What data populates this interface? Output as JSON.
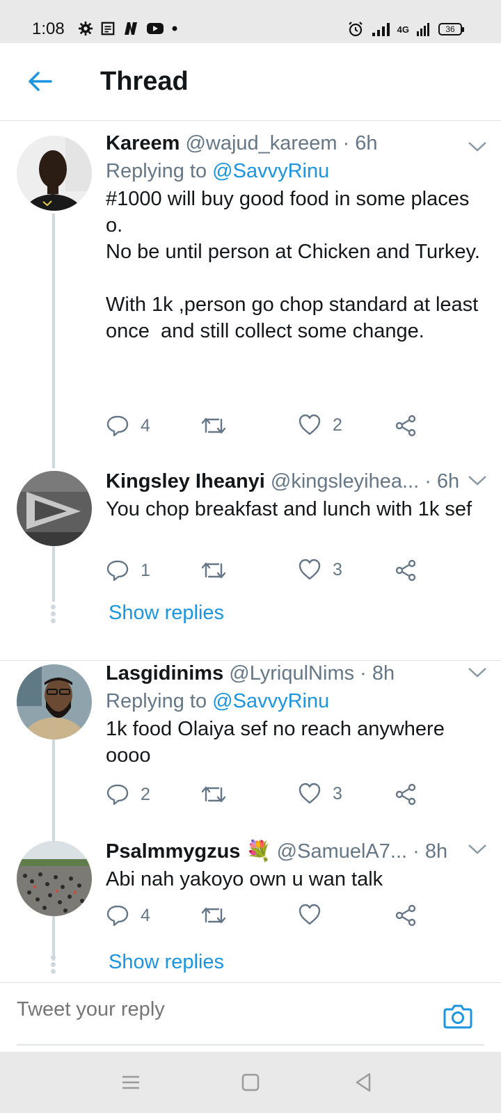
{
  "status_bar": {
    "time": "1:08",
    "battery": "36",
    "network": "4G"
  },
  "header": {
    "title": "Thread"
  },
  "tweets": [
    {
      "name": "Kareem",
      "handle": "@wajud_kareem",
      "time": "· 6h",
      "replying_prefix": "Replying to",
      "replying_to": "@SavvyRinu",
      "text": "#1000 will buy good food in some places o.\nNo be until person at Chicken and Turkey.\n\nWith 1k ,person go chop standard at least once  and still collect some change.",
      "replies": "4",
      "retweets": "",
      "likes": "2"
    },
    {
      "name": "Kingsley Iheanyi",
      "handle": "@kingsleyihea...",
      "time": "· 6h",
      "text": "You chop breakfast and lunch with 1k sef",
      "replies": "1",
      "retweets": "",
      "likes": "3",
      "show_replies": "Show replies"
    },
    {
      "name": "Lasgidinims",
      "handle": "@LyriqulNims",
      "time": "· 8h",
      "replying_prefix": "Replying to",
      "replying_to": "@SavvyRinu",
      "text": "1k food Olaiya sef no reach anywhere oooo",
      "replies": "2",
      "retweets": "",
      "likes": "3"
    },
    {
      "name": "Psalmmygzus",
      "emoji": "💐",
      "handle": "@SamuelA7...",
      "time": "· 8h",
      "text": "Abi nah yakoyo own u wan talk",
      "replies": "4",
      "retweets": "",
      "likes": "",
      "show_replies": "Show replies"
    }
  ],
  "reply_bar": {
    "placeholder": "Tweet your reply"
  },
  "colors": {
    "accent": "#1b95e0",
    "secondary_text": "#657786",
    "thread_line": "#cfd9de"
  }
}
